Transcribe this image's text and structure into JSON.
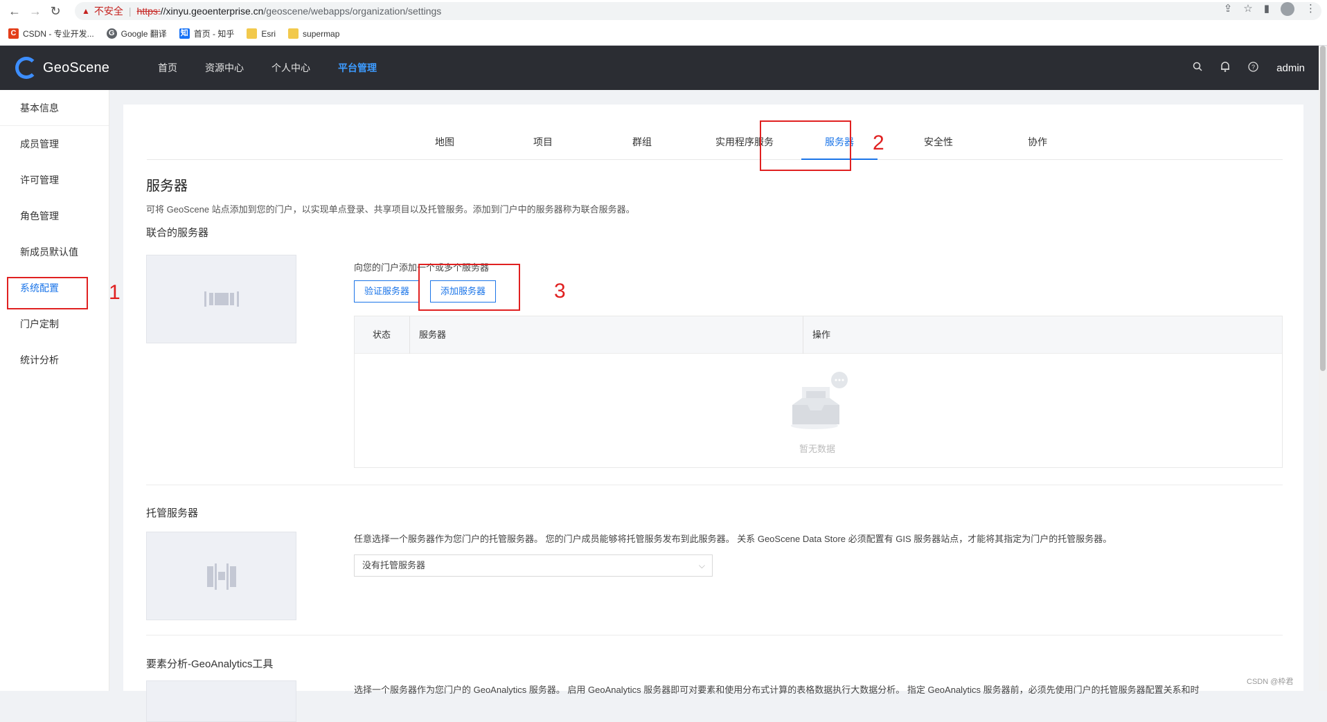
{
  "browser": {
    "security_label": "不安全",
    "url_scheme": "https:",
    "url_host": "//xinyu.geoenterprise.cn",
    "url_path": "/geoscene/webapps/organization/settings",
    "bookmarks": [
      {
        "label": "CSDN - 专业开发...",
        "icon_text": "C",
        "color": "#e33e1a"
      },
      {
        "label": "Google 翻译",
        "icon_text": "G",
        "color": "#5f6368"
      },
      {
        "label": "首页 - 知乎",
        "icon_text": "知",
        "color": "#1772f6"
      },
      {
        "label": "Esri",
        "icon_text": "",
        "color": "#f2c94c"
      },
      {
        "label": "supermap",
        "icon_text": "",
        "color": "#f2c94c"
      }
    ]
  },
  "header": {
    "logo_text": "GeoScene",
    "nav": [
      "首页",
      "资源中心",
      "个人中心",
      "平台管理"
    ],
    "active_nav": "平台管理",
    "user": "admin"
  },
  "sidebar": {
    "items": [
      "基本信息",
      "成员管理",
      "许可管理",
      "角色管理",
      "新成员默认值",
      "系统配置",
      "门户定制",
      "统计分析"
    ],
    "active": "系统配置"
  },
  "tabs": [
    "地图",
    "项目",
    "群组",
    "实用程序服务",
    "服务器",
    "安全性",
    "协作"
  ],
  "active_tab": "服务器",
  "servers_section": {
    "title": "服务器",
    "description": "可将 GeoScene 站点添加到您的门户，以实现单点登录、共享项目以及托管服务。添加到门户中的服务器称为联合服务器。",
    "federated_title": "联合的服务器",
    "add_hint": "向您的门户添加一个或多个服务器",
    "validate_button": "验证服务器",
    "add_button": "添加服务器",
    "table_headers": [
      "状态",
      "服务器",
      "操作"
    ],
    "empty_text": "暂无数据"
  },
  "hosting_section": {
    "title": "托管服务器",
    "description": "任意选择一个服务器作为您门户的托管服务器。 您的门户成员能够将托管服务发布到此服务器。 关系 GeoScene Data Store 必须配置有 GIS 服务器站点，才能将其指定为门户的托管服务器。",
    "select_value": "没有托管服务器"
  },
  "analytics_section": {
    "title": "要素分析-GeoAnalytics工具",
    "description": "选择一个服务器作为您门户的 GeoAnalytics 服务器。 启用 GeoAnalytics 服务器即可对要素和使用分布式计算的表格数据执行大数据分析。 指定 GeoAnalytics 服务器前，必须先使用门户的托管服务器配置关系和时"
  },
  "annotations": [
    "1",
    "2",
    "3"
  ],
  "watermark": "CSDN @枠君"
}
